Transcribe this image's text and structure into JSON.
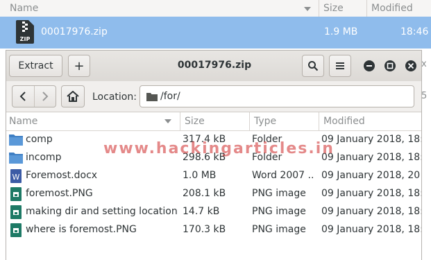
{
  "background": {
    "columns": {
      "name": "Name",
      "size": "Size",
      "modified": "Modified"
    },
    "selected_file": {
      "name": "00017976.zip",
      "size": "1.9 MB",
      "modified": "18:46"
    },
    "edge_fragments": {
      "close_fragment": "x",
      "digit_fragment": "5"
    }
  },
  "window": {
    "title": "00017976.zip",
    "toolbar": {
      "extract_label": "Extract",
      "add_label": "+"
    },
    "location": {
      "label": "Location:",
      "path": "/for/"
    },
    "columns": {
      "name": "Name",
      "size": "Size",
      "type": "Type",
      "modified": "Modified"
    },
    "files": [
      {
        "icon": "folder-icon",
        "name": "comp",
        "size": "317.4 kB",
        "type": "Folder",
        "modified": "09 January 2018, 18:"
      },
      {
        "icon": "folder-icon",
        "name": "incomp",
        "size": "298.6 kB",
        "type": "Folder",
        "modified": "09 January 2018, 18:"
      },
      {
        "icon": "word-document-icon",
        "name": "Foremost.docx",
        "size": "1.0 MB",
        "type": "Word 2007 ...",
        "modified": "09 January 2018, 20"
      },
      {
        "icon": "image-file-icon",
        "name": "foremost.PNG",
        "size": "208.1 kB",
        "type": "PNG image",
        "modified": "09 January 2018, 18:"
      },
      {
        "icon": "image-file-icon",
        "name": "making dir and setting location.P...",
        "size": "14.7 kB",
        "type": "PNG image",
        "modified": "09 January 2018, 18:"
      },
      {
        "icon": "image-file-icon",
        "name": "where is foremost.PNG",
        "size": "170.3 kB",
        "type": "PNG image",
        "modified": "09 January 2018, 18:"
      }
    ]
  },
  "watermark": "www.hackingarticles.in",
  "colors": {
    "selection": "#8fbcec",
    "folder": "#4a86c8",
    "word": "#3b5ba5",
    "image": "#1e7a66"
  }
}
